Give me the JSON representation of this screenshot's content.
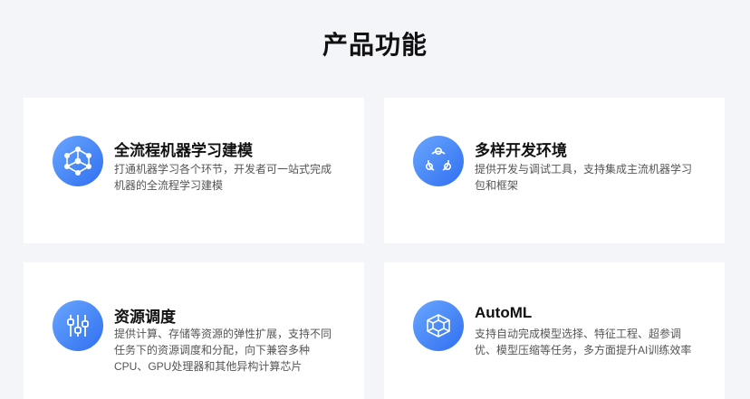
{
  "section": {
    "title": "产品功能"
  },
  "features": [
    {
      "title": "全流程机器学习建模",
      "desc": "打通机器学习各个环节，开发者可一站式完成机器的全流程学习建模",
      "icon": "network-cube-icon"
    },
    {
      "title": "多样开发环境",
      "desc": "提供开发与调试工具，支持集成主流机器学习包和框架",
      "icon": "cycle-nodes-icon"
    },
    {
      "title": "资源调度",
      "desc": "提供计算、存储等资源的弹性扩展，支持不同任务下的资源调度和分配，向下兼容多种CPU、GPU处理器和其他异构计算芯片",
      "icon": "sliders-icon"
    },
    {
      "title": "AutoML",
      "desc": "支持自动完成模型选择、特征工程、超参调优、模型压缩等任务，多方面提升AI训练效率",
      "icon": "layered-cube-icon"
    }
  ],
  "colors": {
    "icon_start": "#6aa6ff",
    "icon_end": "#2f6ff0",
    "background": "#f4f5f9"
  }
}
